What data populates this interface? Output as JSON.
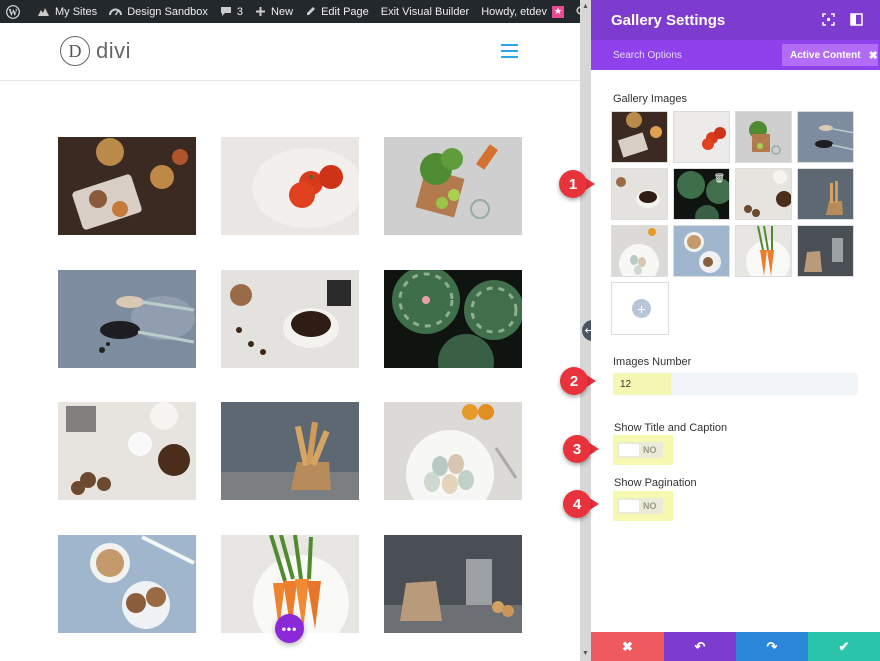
{
  "admin_bar": {
    "my_sites": "My Sites",
    "site_name": "Design Sandbox",
    "comments_count": "3",
    "new_label": "New",
    "edit_page": "Edit Page",
    "exit_builder": "Exit Visual Builder",
    "greeting": "Howdy, etdev"
  },
  "site": {
    "logo_letter": "D",
    "logo_text": "divi"
  },
  "builder": {
    "more_button": "•••"
  },
  "panel": {
    "title": "Gallery Settings",
    "search_options": "Search Options",
    "active_content": "Active Content",
    "gallery_images_label": "Gallery Images",
    "images_number_label": "Images Number",
    "images_number_value": "12",
    "show_title_caption_label": "Show Title and Caption",
    "show_title_caption_value": "NO",
    "show_pagination_label": "Show Pagination",
    "show_pagination_value": "NO"
  },
  "callouts": {
    "one": "1",
    "two": "2",
    "three": "3",
    "four": "4"
  },
  "colors": {
    "panel_header": "#7e3bd0",
    "panel_subheader": "#8f42ec",
    "active_tab": "#b26cf5",
    "callout": "#e8323c",
    "cancel": "#ef5960",
    "undo": "#7e3bd0",
    "redo": "#2b87da",
    "save": "#29c4a9"
  }
}
